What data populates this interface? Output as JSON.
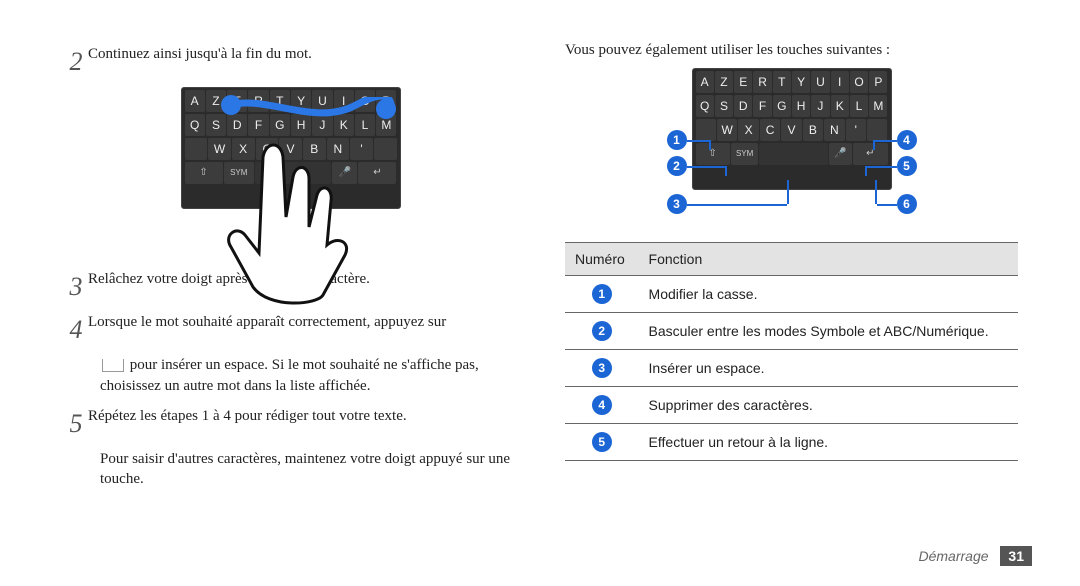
{
  "left": {
    "step2": {
      "num": "2",
      "text": "Continuez ainsi jusqu'à la fin du mot."
    },
    "step3": {
      "num": "3",
      "text": "Relâchez votre doigt après le dernier caractère."
    },
    "step4": {
      "num": "4",
      "text": "Lorsque le mot souhaité apparaît correctement, appuyez sur"
    },
    "step4_cont": "pour insérer un espace. Si le mot souhaité ne s'affiche pas, choisissez un autre mot dans la liste affichée.",
    "step5": {
      "num": "5",
      "text": "Répétez les étapes 1 à 4 pour rédiger tout votre texte."
    },
    "step5_cont": "Pour saisir d'autres caractères, maintenez votre doigt appuyé sur une touche.",
    "kbd_rows": [
      [
        "A",
        "Z",
        "E",
        "R",
        "T",
        "Y",
        "U",
        "I",
        "O",
        "P"
      ],
      [
        "Q",
        "S",
        "D",
        "F",
        "G",
        "H",
        "J",
        "K",
        "L",
        "M"
      ],
      [
        "",
        "W",
        "X",
        "C",
        "V",
        "B",
        "N",
        "'",
        ""
      ]
    ]
  },
  "right": {
    "intro": "Vous pouvez également utiliser les touches suivantes :",
    "kbd_rows": [
      [
        "A",
        "Z",
        "E",
        "R",
        "T",
        "Y",
        "U",
        "I",
        "O",
        "P"
      ],
      [
        "Q",
        "S",
        "D",
        "F",
        "G",
        "H",
        "J",
        "K",
        "L",
        "M"
      ],
      [
        "",
        "W",
        "X",
        "C",
        "V",
        "B",
        "N",
        "'",
        ""
      ]
    ],
    "table": {
      "h1": "Numéro",
      "h2": "Fonction",
      "rows": [
        {
          "n": "1",
          "f": "Modifier la casse."
        },
        {
          "n": "2",
          "f": "Basculer entre les modes Symbole et ABC/Numérique."
        },
        {
          "n": "3",
          "f": "Insérer un espace."
        },
        {
          "n": "4",
          "f": "Supprimer des caractères."
        },
        {
          "n": "5",
          "f": "Effectuer un retour à la ligne."
        }
      ]
    }
  },
  "footer": {
    "chapter": "Démarrage",
    "page": "31"
  }
}
